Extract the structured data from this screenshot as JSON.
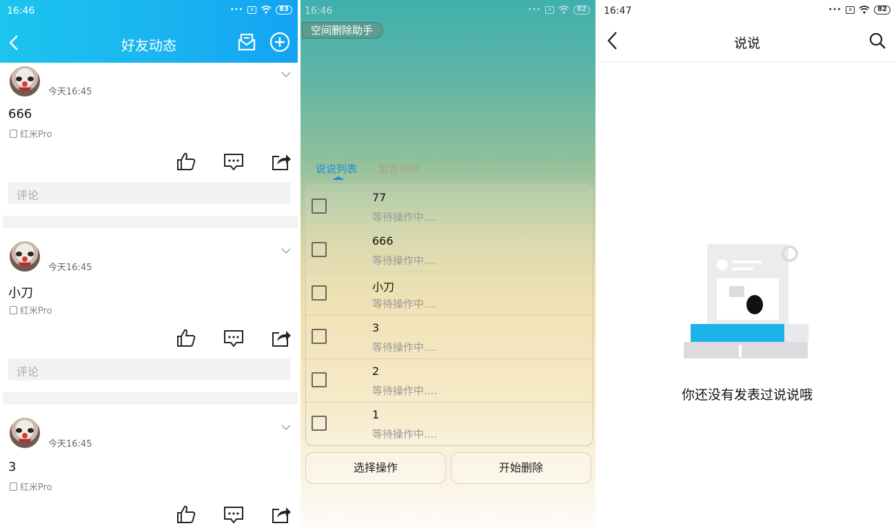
{
  "friends_feed": {
    "status": {
      "time": "16:46",
      "battery": "83",
      "sim_label": "x"
    },
    "title": "好友动态",
    "posts": [
      {
        "time": "今天16:45",
        "text": "666",
        "device": "红米Pro",
        "comment_placeholder": "评论"
      },
      {
        "time": "今天16:45",
        "text": "小刀",
        "device": "红米Pro",
        "comment_placeholder": "评论"
      },
      {
        "time": "今天16:45",
        "text": "3",
        "device": "红米Pro"
      }
    ]
  },
  "delete_helper": {
    "status": {
      "time": "16:46",
      "battery": "82",
      "sim_label": "x"
    },
    "app_tag": "空间删除助手",
    "tabs": [
      "说说列表",
      "留言列表"
    ],
    "active_tab": 0,
    "rows": [
      {
        "name": "77",
        "status": "等待操作中...."
      },
      {
        "name": "666",
        "status": "等待操作中...."
      },
      {
        "name": "小刀",
        "status": "等待操作中...."
      },
      {
        "name": "3",
        "status": "等待操作中...."
      },
      {
        "name": "2",
        "status": "等待操作中...."
      },
      {
        "name": "1",
        "status": "等待操作中...."
      }
    ],
    "buttons": {
      "select": "选择操作",
      "start": "开始删除"
    }
  },
  "shuoshuo": {
    "status": {
      "time": "16:47",
      "battery": "82",
      "sim_label": "x"
    },
    "title": "说说",
    "empty_text": "你还没有发表过说说哦"
  },
  "colors": {
    "header_blue": "#1ab6f0",
    "tab_active": "#1a8fd8",
    "illus_blue": "#1ab3ea"
  }
}
